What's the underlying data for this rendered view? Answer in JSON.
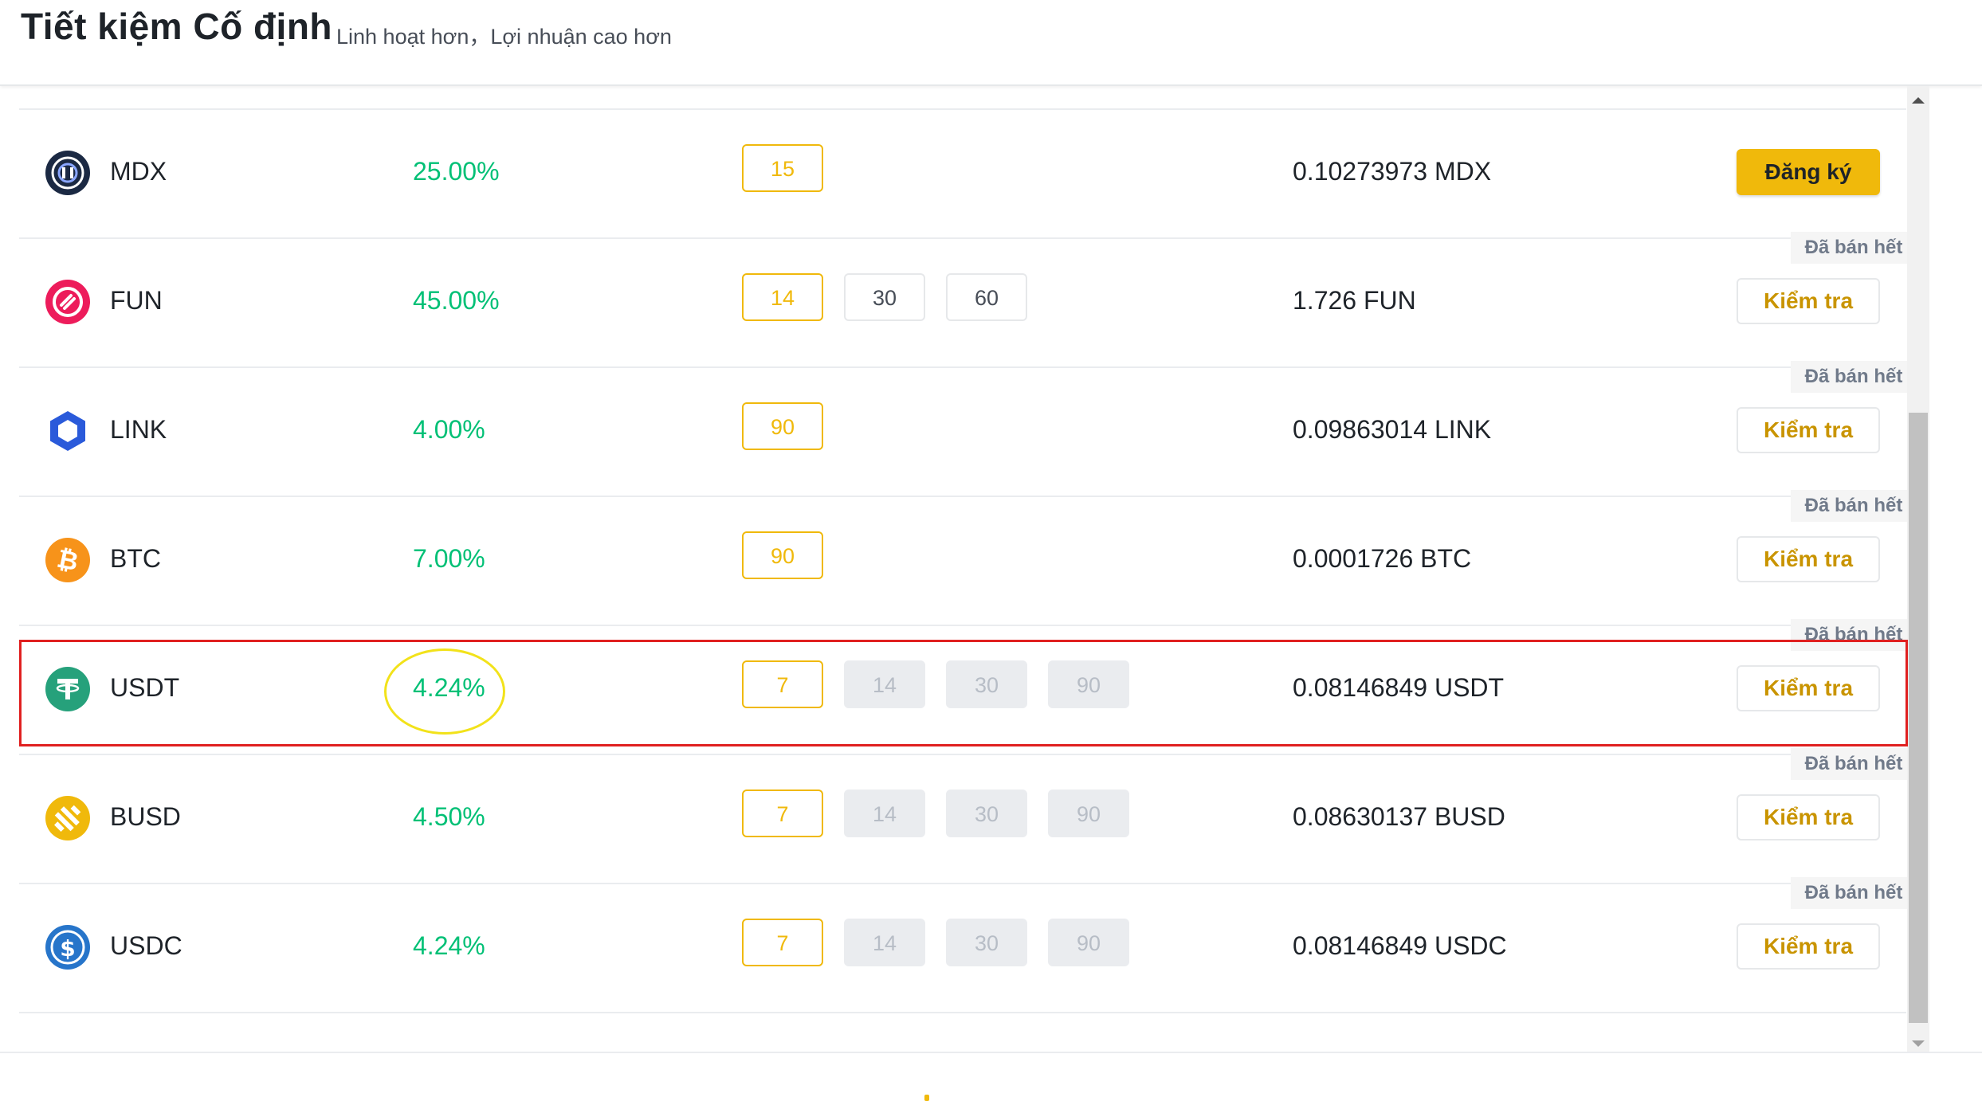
{
  "header": {
    "title": "Tiết kiệm Cố định",
    "subtitle": "Linh hoạt hơn，Lợi nhuận cao hơn"
  },
  "rows": [
    {
      "coin": "MDX",
      "apy": "25.00%",
      "durations": [
        {
          "label": "15",
          "state": "active"
        }
      ],
      "available": "0.10273973 MDX",
      "sold_out": "",
      "action": "Đăng ký",
      "action_style": "primary",
      "icon": "mdx-icon",
      "icon_color": "#1b2943"
    },
    {
      "coin": "FUN",
      "apy": "45.00%",
      "durations": [
        {
          "label": "14",
          "state": "active"
        },
        {
          "label": "30",
          "state": "normal"
        },
        {
          "label": "60",
          "state": "normal"
        }
      ],
      "available": "1.726 FUN",
      "sold_out": "Đã bán hết",
      "action": "Kiểm tra",
      "action_style": "secondary",
      "icon": "fun-icon",
      "icon_color": "#ed1c5b"
    },
    {
      "coin": "LINK",
      "apy": "4.00%",
      "durations": [
        {
          "label": "90",
          "state": "active"
        }
      ],
      "available": "0.09863014 LINK",
      "sold_out": "Đã bán hết",
      "action": "Kiểm tra",
      "action_style": "secondary",
      "icon": "link-icon",
      "icon_color": "#2a5ada"
    },
    {
      "coin": "BTC",
      "apy": "7.00%",
      "durations": [
        {
          "label": "90",
          "state": "active"
        }
      ],
      "available": "0.0001726 BTC",
      "sold_out": "Đã bán hết",
      "action": "Kiểm tra",
      "action_style": "secondary",
      "icon": "btc-icon",
      "icon_color": "#f7931a"
    },
    {
      "coin": "USDT",
      "apy": "4.24%",
      "durations": [
        {
          "label": "7",
          "state": "active"
        },
        {
          "label": "14",
          "state": "disabled"
        },
        {
          "label": "30",
          "state": "disabled"
        },
        {
          "label": "90",
          "state": "disabled"
        }
      ],
      "available": "0.08146849 USDT",
      "sold_out": "Đã bán hết",
      "action": "Kiểm tra",
      "action_style": "secondary",
      "icon": "usdt-icon",
      "icon_color": "#26a17b"
    },
    {
      "coin": "BUSD",
      "apy": "4.50%",
      "durations": [
        {
          "label": "7",
          "state": "active"
        },
        {
          "label": "14",
          "state": "disabled"
        },
        {
          "label": "30",
          "state": "disabled"
        },
        {
          "label": "90",
          "state": "disabled"
        }
      ],
      "available": "0.08630137 BUSD",
      "sold_out": "Đã bán hết",
      "action": "Kiểm tra",
      "action_style": "secondary",
      "icon": "busd-icon",
      "icon_color": "#f0b90b"
    },
    {
      "coin": "USDC",
      "apy": "4.24%",
      "durations": [
        {
          "label": "7",
          "state": "active"
        },
        {
          "label": "14",
          "state": "disabled"
        },
        {
          "label": "30",
          "state": "disabled"
        },
        {
          "label": "90",
          "state": "disabled"
        }
      ],
      "available": "0.08146849 USDC",
      "sold_out": "Đã bán hết",
      "action": "Kiểm tra",
      "action_style": "secondary",
      "icon": "usdc-icon",
      "icon_color": "#2775ca"
    }
  ],
  "colors": {
    "accent": "#f0b90b",
    "apy_green": "#02c076",
    "highlight_red": "#e02020",
    "highlight_yellow": "#f2e21a"
  }
}
